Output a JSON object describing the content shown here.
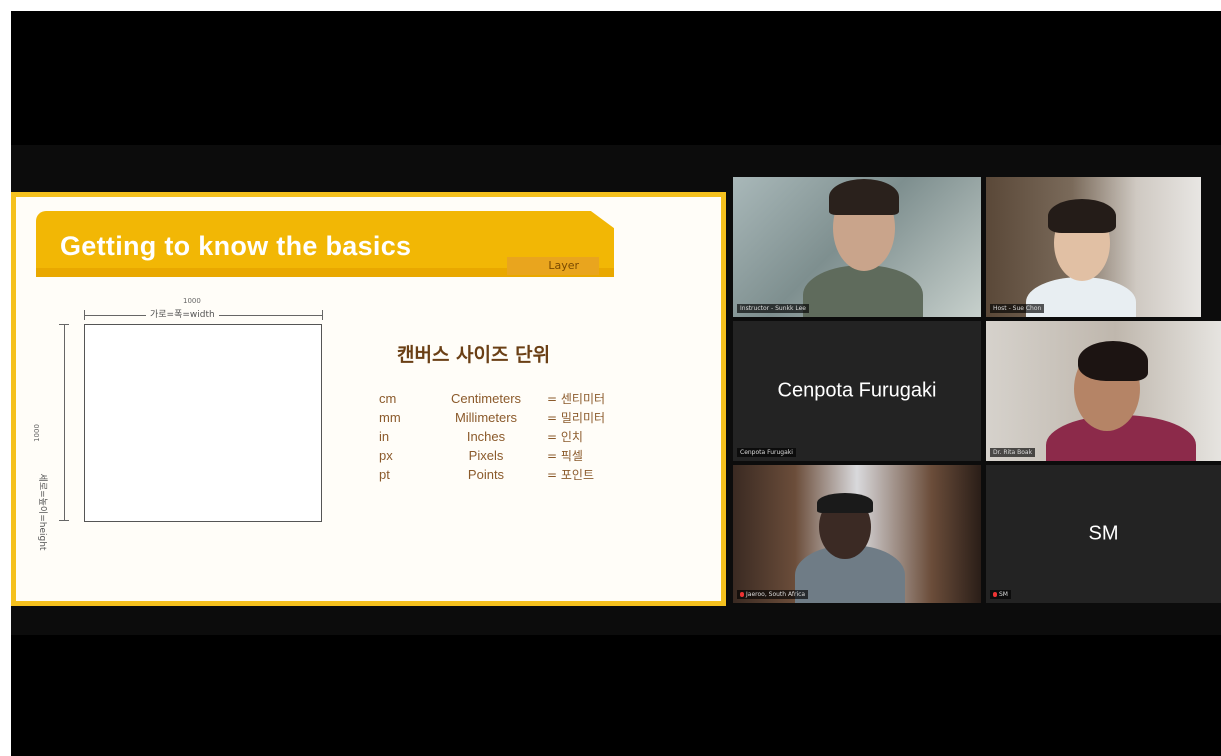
{
  "slide": {
    "title": "Getting to know the basics",
    "tag": "Layer",
    "width_label": "가로=폭=width",
    "width_value": "1000",
    "height_label": "세로=높이=height",
    "height_value": "1000",
    "units_heading": "캔버스 사이즈 단위",
    "units": [
      {
        "abbr": "cm",
        "name": "Centimeters",
        "kor": "= 센티미터"
      },
      {
        "abbr": "mm",
        "name": "Millimeters",
        "kor": "= 밀리미터"
      },
      {
        "abbr": "in",
        "name": "Inches",
        "kor": "= 인치"
      },
      {
        "abbr": "px",
        "name": "Pixels",
        "kor": "= 픽셀"
      },
      {
        "abbr": "pt",
        "name": "Points",
        "kor": "= 포인트"
      }
    ]
  },
  "participants": [
    {
      "id": "p1",
      "name_tag": "Instructor - Sunkk Lee",
      "video": true,
      "active": true
    },
    {
      "id": "p2",
      "name_tag": "Host - Sue Chon",
      "video": true
    },
    {
      "id": "p3",
      "display_name": "Cenpota Furugaki",
      "name_tag": "Cenpota Furugaki",
      "video": false
    },
    {
      "id": "p4",
      "name_tag": "Dr. Rita Boak",
      "video": true
    },
    {
      "id": "p5",
      "name_tag": "Jaeroo, South Africa",
      "video": true,
      "muted": true
    },
    {
      "id": "p6",
      "display_name": "SM",
      "name_tag": "SM",
      "video": false,
      "muted": true
    }
  ]
}
